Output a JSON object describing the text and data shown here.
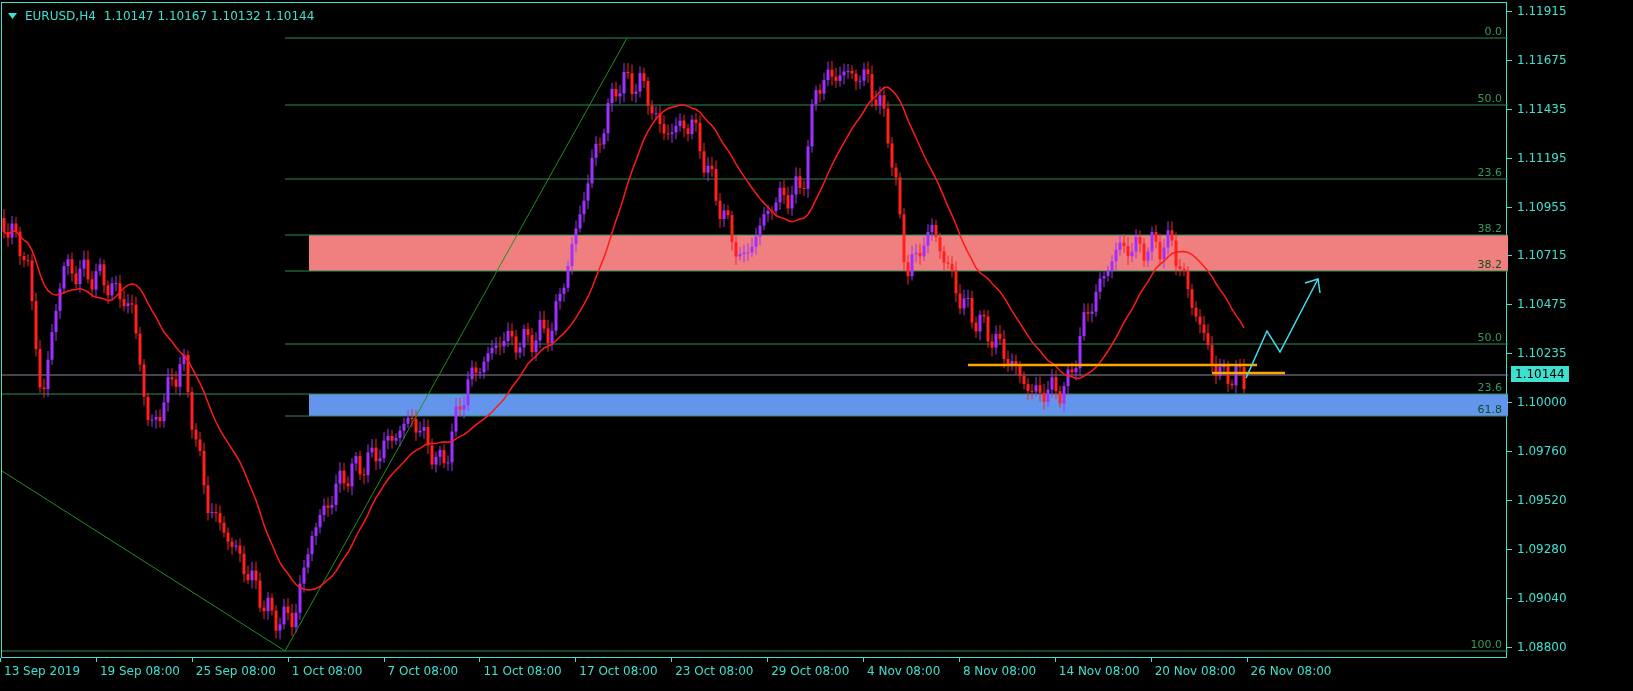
{
  "header": {
    "symbol": "EURUSD,H4",
    "prices": [
      "1.10147",
      "1.10167",
      "1.10132",
      "1.10144"
    ]
  },
  "chart": {
    "fib_labels": [
      "0.0",
      "50.0",
      "23.6",
      "38.2",
      "38.2",
      "50.0",
      "23.6",
      "61.8",
      "100.0"
    ],
    "zones": [
      {
        "color": "#f08080"
      },
      {
        "color": "#6495ed"
      }
    ]
  },
  "price_axis": [
    "1.11915",
    "1.11675",
    "1.11435",
    "1.11195",
    "1.10955",
    "1.10715",
    "1.10475",
    "1.10235",
    "1.10000",
    "1.09760",
    "1.09520",
    "1.09280",
    "1.09040",
    "1.08800"
  ],
  "current_price": "1.10144",
  "time_axis": [
    "13 Sep 2019",
    "19 Sep 08:00",
    "25 Sep 08:00",
    "1 Oct 08:00",
    "7 Oct 08:00",
    "11 Oct 08:00",
    "17 Oct 08:00",
    "23 Oct 08:00",
    "29 Oct 08:00",
    "4 Nov 08:00",
    "8 Nov 08:00",
    "14 Nov 08:00",
    "20 Nov 08:00",
    "26 Nov 08:00"
  ]
}
